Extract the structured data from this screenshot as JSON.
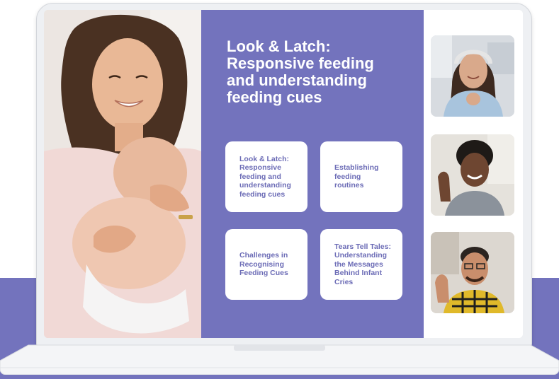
{
  "course": {
    "title": "Look & Latch:\nResponsive feeding\nand understanding\nfeeding cues",
    "modules": [
      {
        "label": "Look & Latch:\nResponsive\nfeeding and\nunderstanding\nfeeding cues"
      },
      {
        "label": "Establishing\nfeeding\nroutines"
      },
      {
        "label": "Challenges in\nRecognising\nFeeding Cues"
      },
      {
        "label": "Tears Tell Tales:\nUnderstanding\nthe Messages\nBehind Infant\nCries"
      }
    ]
  },
  "colors": {
    "brand_purple": "#7373bd",
    "card_text": "#6c6cb6",
    "card_bg": "#ffffff"
  },
  "media": {
    "main_photo": "mother-and-baby-photo",
    "video_participants": [
      "participant-woman-with-headphones",
      "participant-man-waving",
      "participant-man-with-glasses-waving"
    ]
  }
}
